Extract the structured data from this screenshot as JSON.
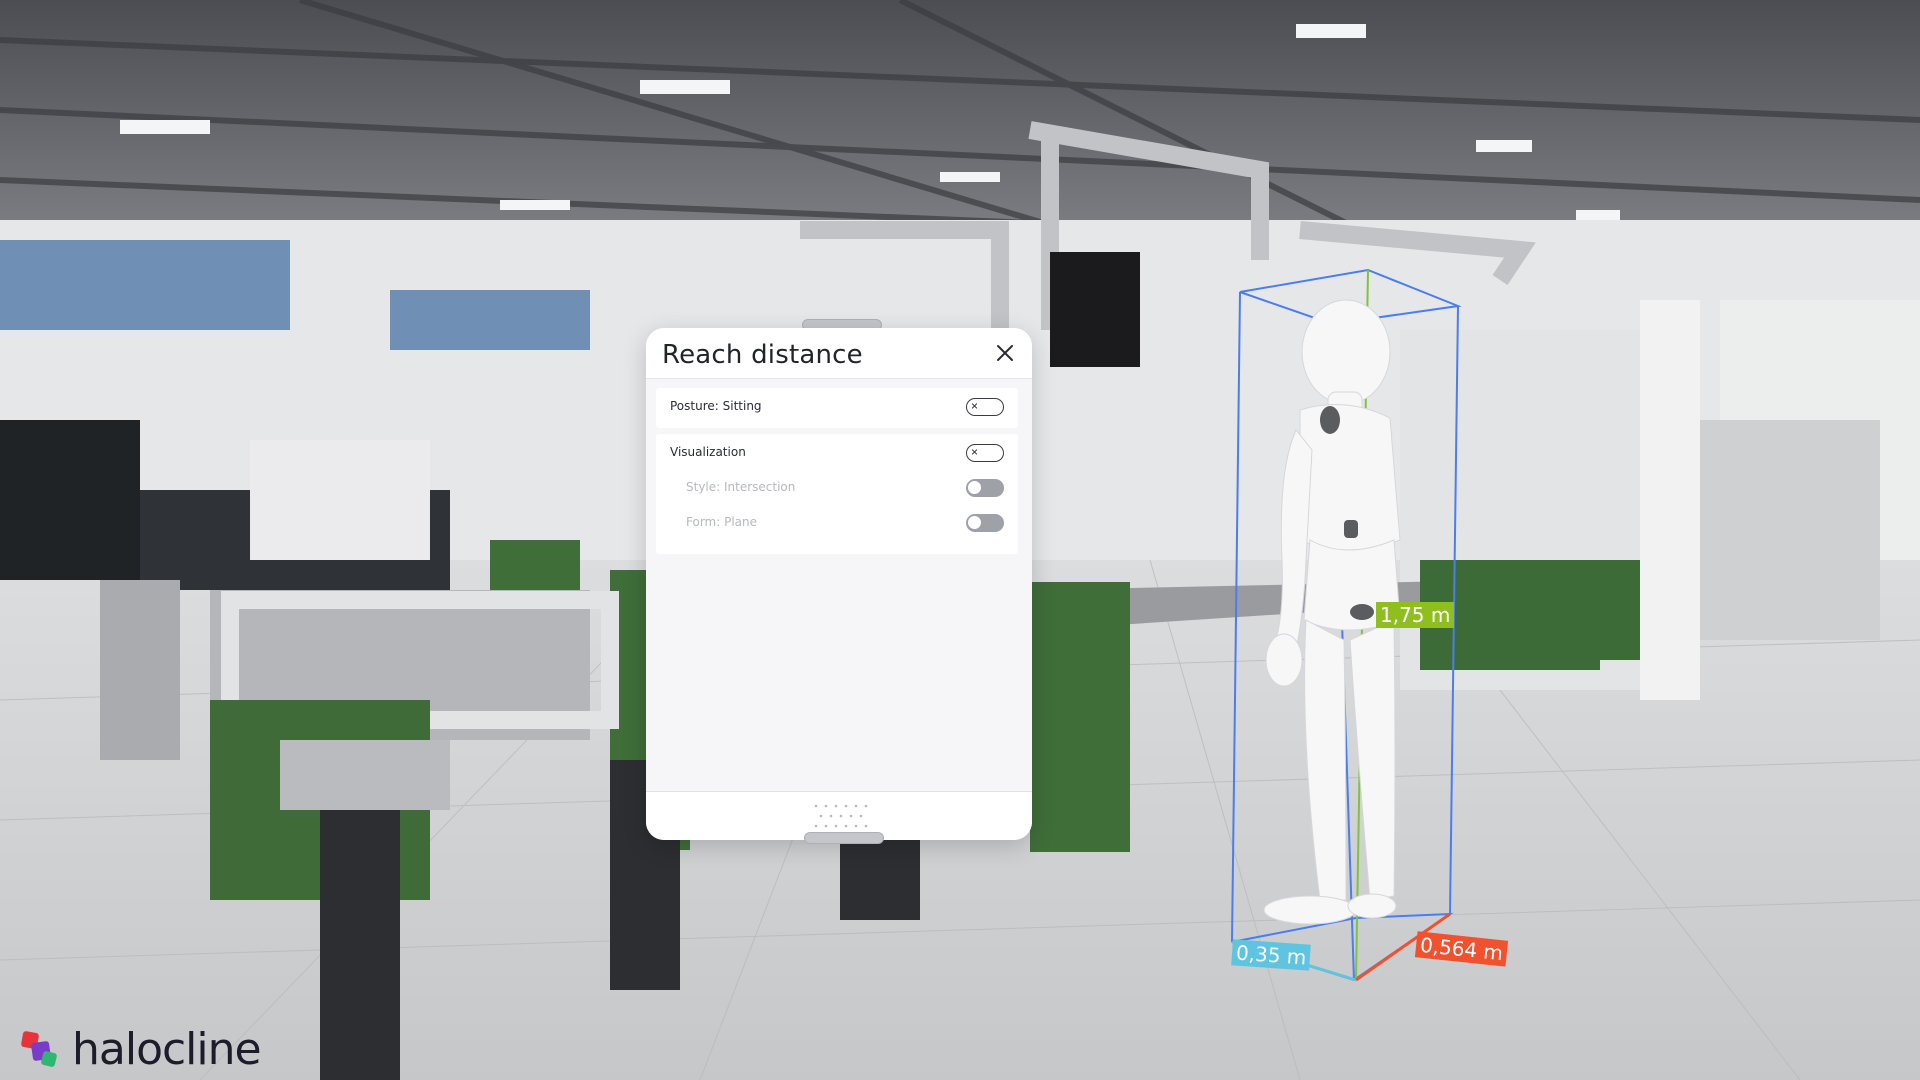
{
  "panel": {
    "title": "Reach distance",
    "rows": [
      {
        "label": "Posture: Sitting",
        "state": "on"
      },
      {
        "label": "Visualization",
        "state": "on"
      },
      {
        "label": "Style: Intersection",
        "state": "off"
      },
      {
        "label": "Form: Plane",
        "state": "off"
      }
    ]
  },
  "measurements": {
    "height": "1,75 m",
    "depth": "0,35 m",
    "width": "0,564 m"
  },
  "brand": {
    "name": "halocline",
    "colors": {
      "red": "#e8333b",
      "purple": "#7a3cc8",
      "green": "#2fb673"
    }
  },
  "colors": {
    "height_tag": "#8fbf1f",
    "depth_tag": "#5fc4df",
    "width_tag": "#f0512e",
    "bounding_box": "#4a7df0"
  }
}
